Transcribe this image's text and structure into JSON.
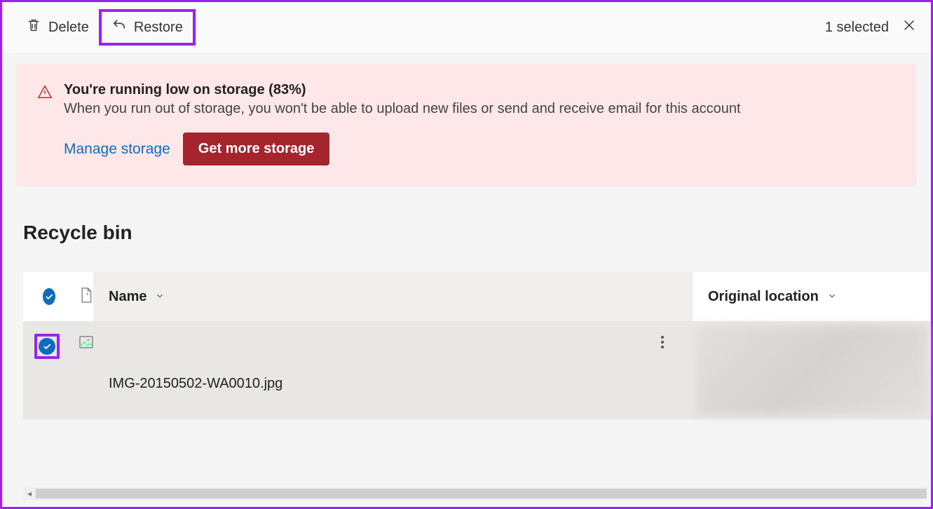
{
  "toolbar": {
    "delete_label": "Delete",
    "restore_label": "Restore",
    "selection_status": "1 selected"
  },
  "banner": {
    "title": "You're running low on storage (83%)",
    "message": "When you run out of storage, you won't be able to upload new files or send and receive email for this account",
    "manage_link": "Manage storage",
    "cta": "Get more storage"
  },
  "page": {
    "title": "Recycle bin"
  },
  "table": {
    "headers": {
      "name": "Name",
      "original_location": "Original location"
    },
    "rows": [
      {
        "name": "IMG-20150502-WA0010.jpg",
        "selected": true,
        "type": "image"
      }
    ]
  },
  "icons": {
    "trash": "trash-icon",
    "undo": "undo-icon",
    "close": "close-icon",
    "warning": "warning-icon",
    "file": "file-icon",
    "image": "image-icon",
    "chevron_down": "chevron-down-icon",
    "more_vertical": "more-vertical-icon",
    "check": "check-icon"
  },
  "colors": {
    "accent": "#0f6cbd",
    "danger_bg": "#fde7e9",
    "danger_btn": "#a4262c",
    "highlight": "#a020f0"
  }
}
